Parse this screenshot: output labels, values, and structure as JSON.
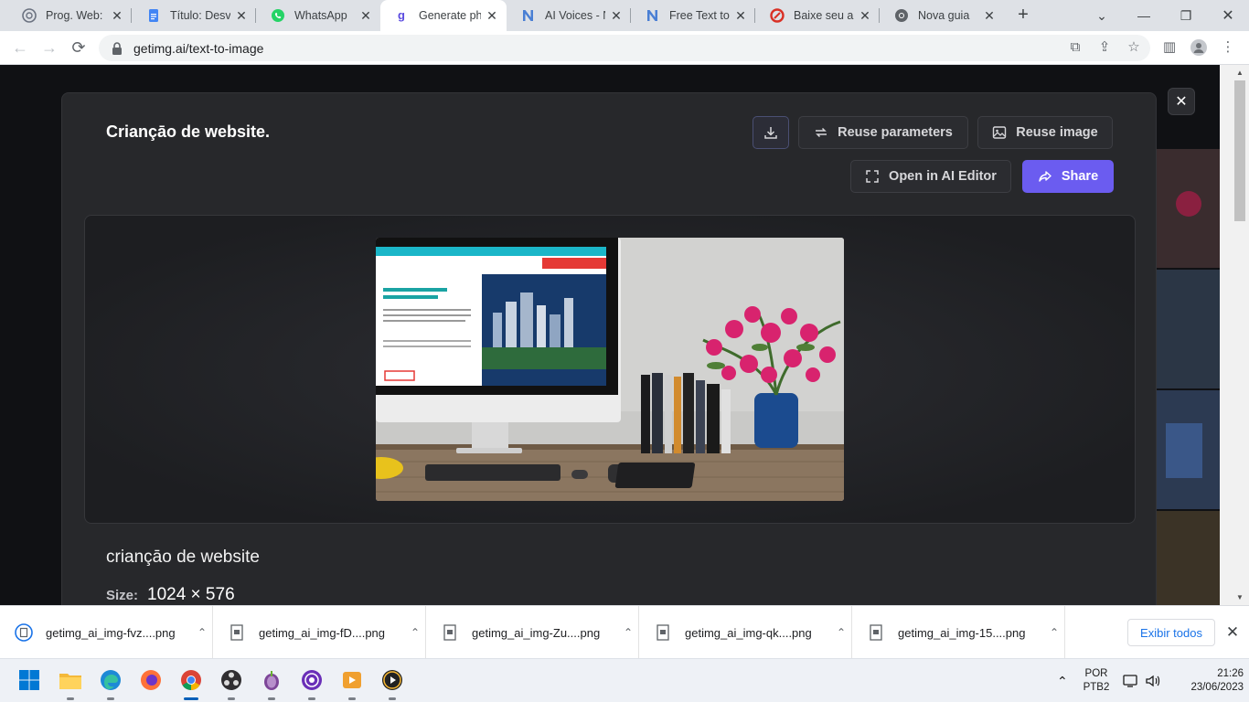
{
  "browser": {
    "tabs": [
      {
        "title": "Prog. Web: Cr",
        "icon": "chatgpt-icon"
      },
      {
        "title": "Título: Desve",
        "icon": "google-docs-icon"
      },
      {
        "title": "WhatsApp",
        "icon": "whatsapp-icon"
      },
      {
        "title": "Generate pho",
        "icon": "getimg-icon",
        "active": true
      },
      {
        "title": "AI Voices - Na",
        "icon": "notion-n-icon"
      },
      {
        "title": "Free Text to S",
        "icon": "notion-n-icon"
      },
      {
        "title": "Baixe seu arq",
        "icon": "red-circle-icon"
      },
      {
        "title": "Nova guia",
        "icon": "chrome-icon"
      }
    ],
    "url": "getimg.ai/text-to-image"
  },
  "modal": {
    "title": "Criançāo de website.",
    "buttons": {
      "download": "download-icon",
      "reuse_parameters": "Reuse parameters",
      "reuse_image": "Reuse image",
      "open_editor": "Open in AI Editor",
      "share": "Share"
    },
    "prompt": "criançāo de website",
    "size_label": "Size:",
    "size_value": "1024 × 576",
    "accent": "#6b5cf0"
  },
  "downloads": {
    "items": [
      {
        "name": "getimg_ai_img-fvz....png"
      },
      {
        "name": "getimg_ai_img-fD....png"
      },
      {
        "name": "getimg_ai_img-Zu....png"
      },
      {
        "name": "getimg_ai_img-qk....png"
      },
      {
        "name": "getimg_ai_img-15....png"
      }
    ],
    "show_all": "Exibir todos"
  },
  "taskbar": {
    "lang_top": "POR",
    "lang_bottom": "PTB2",
    "time": "21:26",
    "date": "23/06/2023"
  }
}
